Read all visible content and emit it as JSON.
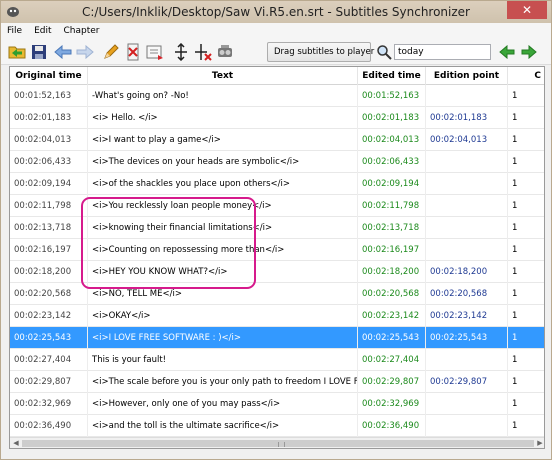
{
  "window": {
    "title": "C:/Users/Inklik/Desktop/Saw Vi.R5.en.srt - Subtitles Synchronizer",
    "close_label": "✕"
  },
  "menu": [
    "File",
    "Edit",
    "Chapter"
  ],
  "toolbar": {
    "buttons": [
      "open-folder-icon",
      "save-icon",
      "back-arrow-icon",
      "forward-arrow-icon",
      "pencil-icon",
      "delete-edition-point-icon",
      "insert-icon",
      "align-icon",
      "remove-align-icon",
      "speaker-icon"
    ],
    "drag_label": "Drag subtitles to player",
    "search_value": "today",
    "search_prev": "prev-arrow-icon",
    "search_next": "next-arrow-icon"
  },
  "columns": [
    "Original time",
    "Text",
    "Edited time",
    "Edition point",
    "C"
  ],
  "rows": [
    {
      "orig": "00:01:52,163",
      "text": "-What's going on? -No!",
      "edit": "00:01:52,163",
      "ep": "",
      "c": "1"
    },
    {
      "orig": "00:02:01,183",
      "text": "<i> Hello. </i>",
      "edit": "00:02:01,183",
      "ep": "00:02:01,183",
      "c": "1"
    },
    {
      "orig": "00:02:04,013",
      "text": "<i>I want to play a game</i>",
      "edit": "00:02:04,013",
      "ep": "00:02:04,013",
      "c": "1"
    },
    {
      "orig": "00:02:06,433",
      "text": "<i>The devices on your heads are symbolic</i>",
      "edit": "00:02:06,433",
      "ep": "",
      "c": "1"
    },
    {
      "orig": "00:02:09,194",
      "text": "<i>of the shackles you place upon others</i>",
      "edit": "00:02:09,194",
      "ep": "",
      "c": "1"
    },
    {
      "orig": "00:02:11,798",
      "text": "<i>You recklessly loan people money</i>",
      "edit": "00:02:11,798",
      "ep": "",
      "c": "1"
    },
    {
      "orig": "00:02:13,718",
      "text": "<i>knowing their financial limitations</i>",
      "edit": "00:02:13,718",
      "ep": "",
      "c": "1"
    },
    {
      "orig": "00:02:16,197",
      "text": "<i>Counting on repossessing more than</i>",
      "edit": "00:02:16,197",
      "ep": "",
      "c": "1"
    },
    {
      "orig": "00:02:18,200",
      "text": "<i>HEY YOU KNOW WHAT?</i>",
      "edit": "00:02:18,200",
      "ep": "00:02:18,200",
      "c": "1"
    },
    {
      "orig": "00:02:20,568",
      "text": "<i>NO, TELL ME</i>",
      "edit": "00:02:20,568",
      "ep": "00:02:20,568",
      "c": "1"
    },
    {
      "orig": "00:02:23,142",
      "text": "<i>OKAY</i>",
      "edit": "00:02:23,142",
      "ep": "00:02:23,142",
      "c": "1"
    },
    {
      "orig": "00:02:25,543",
      "text": "<i>I LOVE FREE SOFTWARE : )</i>",
      "edit": "00:02:25,543",
      "ep": "00:02:25,543",
      "c": "1",
      "selected": true
    },
    {
      "orig": "00:02:27,404",
      "text": "This is your fault!",
      "edit": "00:02:27,404",
      "ep": "",
      "c": "1"
    },
    {
      "orig": "00:02:29,807",
      "text": "<i>The scale before you is your only path to freedom  I LOVE FRE...",
      "edit": "00:02:29,807",
      "ep": "00:02:29,807",
      "c": "1"
    },
    {
      "orig": "00:02:32,969",
      "text": "<i>However, only one of you may pass</i>",
      "edit": "00:02:32,969",
      "ep": "",
      "c": "1"
    },
    {
      "orig": "00:02:36,490",
      "text": "<i>and the toll is the ultimate sacrifice</i>",
      "edit": "00:02:36,490",
      "ep": "",
      "c": "1"
    }
  ],
  "colors": {
    "selection": "#3399ff",
    "edited_time": "#1c8a1c",
    "edition_point": "#1f3a93",
    "highlight": "#d61a8c"
  }
}
